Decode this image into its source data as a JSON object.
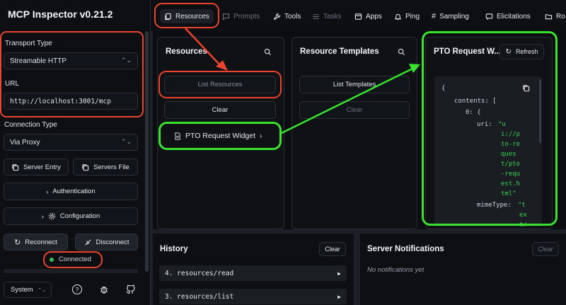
{
  "app": {
    "title": "MCP Inspector v0.21.2"
  },
  "sidebar": {
    "transport_label": "Transport Type",
    "transport_value": "Streamable HTTP",
    "url_label": "URL",
    "url_value": "http://localhost:3001/mcp",
    "connection_label": "Connection Type",
    "connection_value": "Via Proxy",
    "server_entry_label": "Server Entry",
    "servers_file_label": "Servers File",
    "authentication_label": "Authentication",
    "configuration_label": "Configuration",
    "reconnect_label": "Reconnect",
    "disconnect_label": "Disconnect",
    "status_text": "Connected",
    "status_color": "#3fb950",
    "theme_value": "System"
  },
  "tabs": [
    {
      "label": "Resources",
      "icon": "resources-icon",
      "state": "active"
    },
    {
      "label": "Prompts",
      "icon": "chat-icon",
      "state": "disabled"
    },
    {
      "label": "Tools",
      "icon": "wrench-icon",
      "state": "enabled"
    },
    {
      "label": "Tasks",
      "icon": "tasks-icon",
      "state": "disabled"
    },
    {
      "label": "Apps",
      "icon": "apps-icon",
      "state": "enabled"
    },
    {
      "label": "Ping",
      "icon": "bell-icon",
      "state": "enabled"
    },
    {
      "label": "Sampling",
      "icon": "hash-icon",
      "state": "enabled"
    },
    {
      "label": "Elicitations",
      "icon": "message-icon",
      "state": "enabled"
    },
    {
      "label": "Ro",
      "icon": "folder-icon",
      "state": "enabled"
    }
  ],
  "resources": {
    "title": "Resources",
    "list_button": "List Resources",
    "clear_button": "Clear",
    "item_label": "PTO Request Widget"
  },
  "templates": {
    "title": "Resource Templates",
    "list_button": "List Templates",
    "clear_button": "Clear"
  },
  "detail": {
    "title": "PTO Request W...",
    "refresh_button": "Refresh",
    "code_lines": [
      {
        "text": "{",
        "kind": "punct"
      },
      {
        "text": "contents: [",
        "kind": "key"
      },
      {
        "text": "0: {",
        "kind": "key"
      },
      {
        "text": "uri:",
        "kind": "key"
      },
      {
        "text": "\"u",
        "kind": "str"
      },
      {
        "text": "i://p",
        "kind": "str"
      },
      {
        "text": "to-re",
        "kind": "str"
      },
      {
        "text": "ques",
        "kind": "str"
      },
      {
        "text": "t/pto",
        "kind": "str"
      },
      {
        "text": "-requ",
        "kind": "str"
      },
      {
        "text": "est.h",
        "kind": "str"
      },
      {
        "text": "tml\"",
        "kind": "str"
      },
      {
        "text": "mimeType:",
        "kind": "key"
      },
      {
        "text": "\"t",
        "kind": "str"
      },
      {
        "text": "ex",
        "kind": "str"
      },
      {
        "text": "t/",
        "kind": "str"
      }
    ]
  },
  "history": {
    "title": "History",
    "clear_button": "Clear",
    "items": [
      "4. resources/read",
      "3. resources/list"
    ]
  },
  "notifications": {
    "title": "Server Notifications",
    "clear_button": "Clear",
    "empty_text": "No notifications yet"
  },
  "colors": {
    "annotation_red": "#e8442e",
    "annotation_green": "#38e22f"
  }
}
